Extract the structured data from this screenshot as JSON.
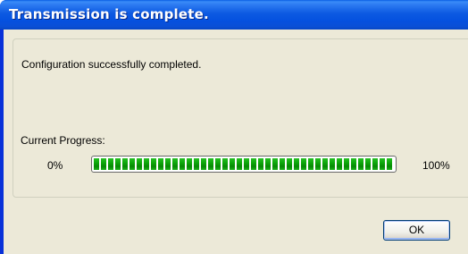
{
  "window": {
    "title": "Transmission is complete."
  },
  "dialog": {
    "message": "Configuration successfully completed.",
    "progress_label": "Current Progress:",
    "progress_start": "0%",
    "progress_end": "100%",
    "progress_value_percent": 100,
    "ok_label": "OK"
  },
  "colors": {
    "titlebar": "#0a5ee4",
    "dialog_background": "#ece9d8",
    "progress_fill": "#2fc62b"
  }
}
